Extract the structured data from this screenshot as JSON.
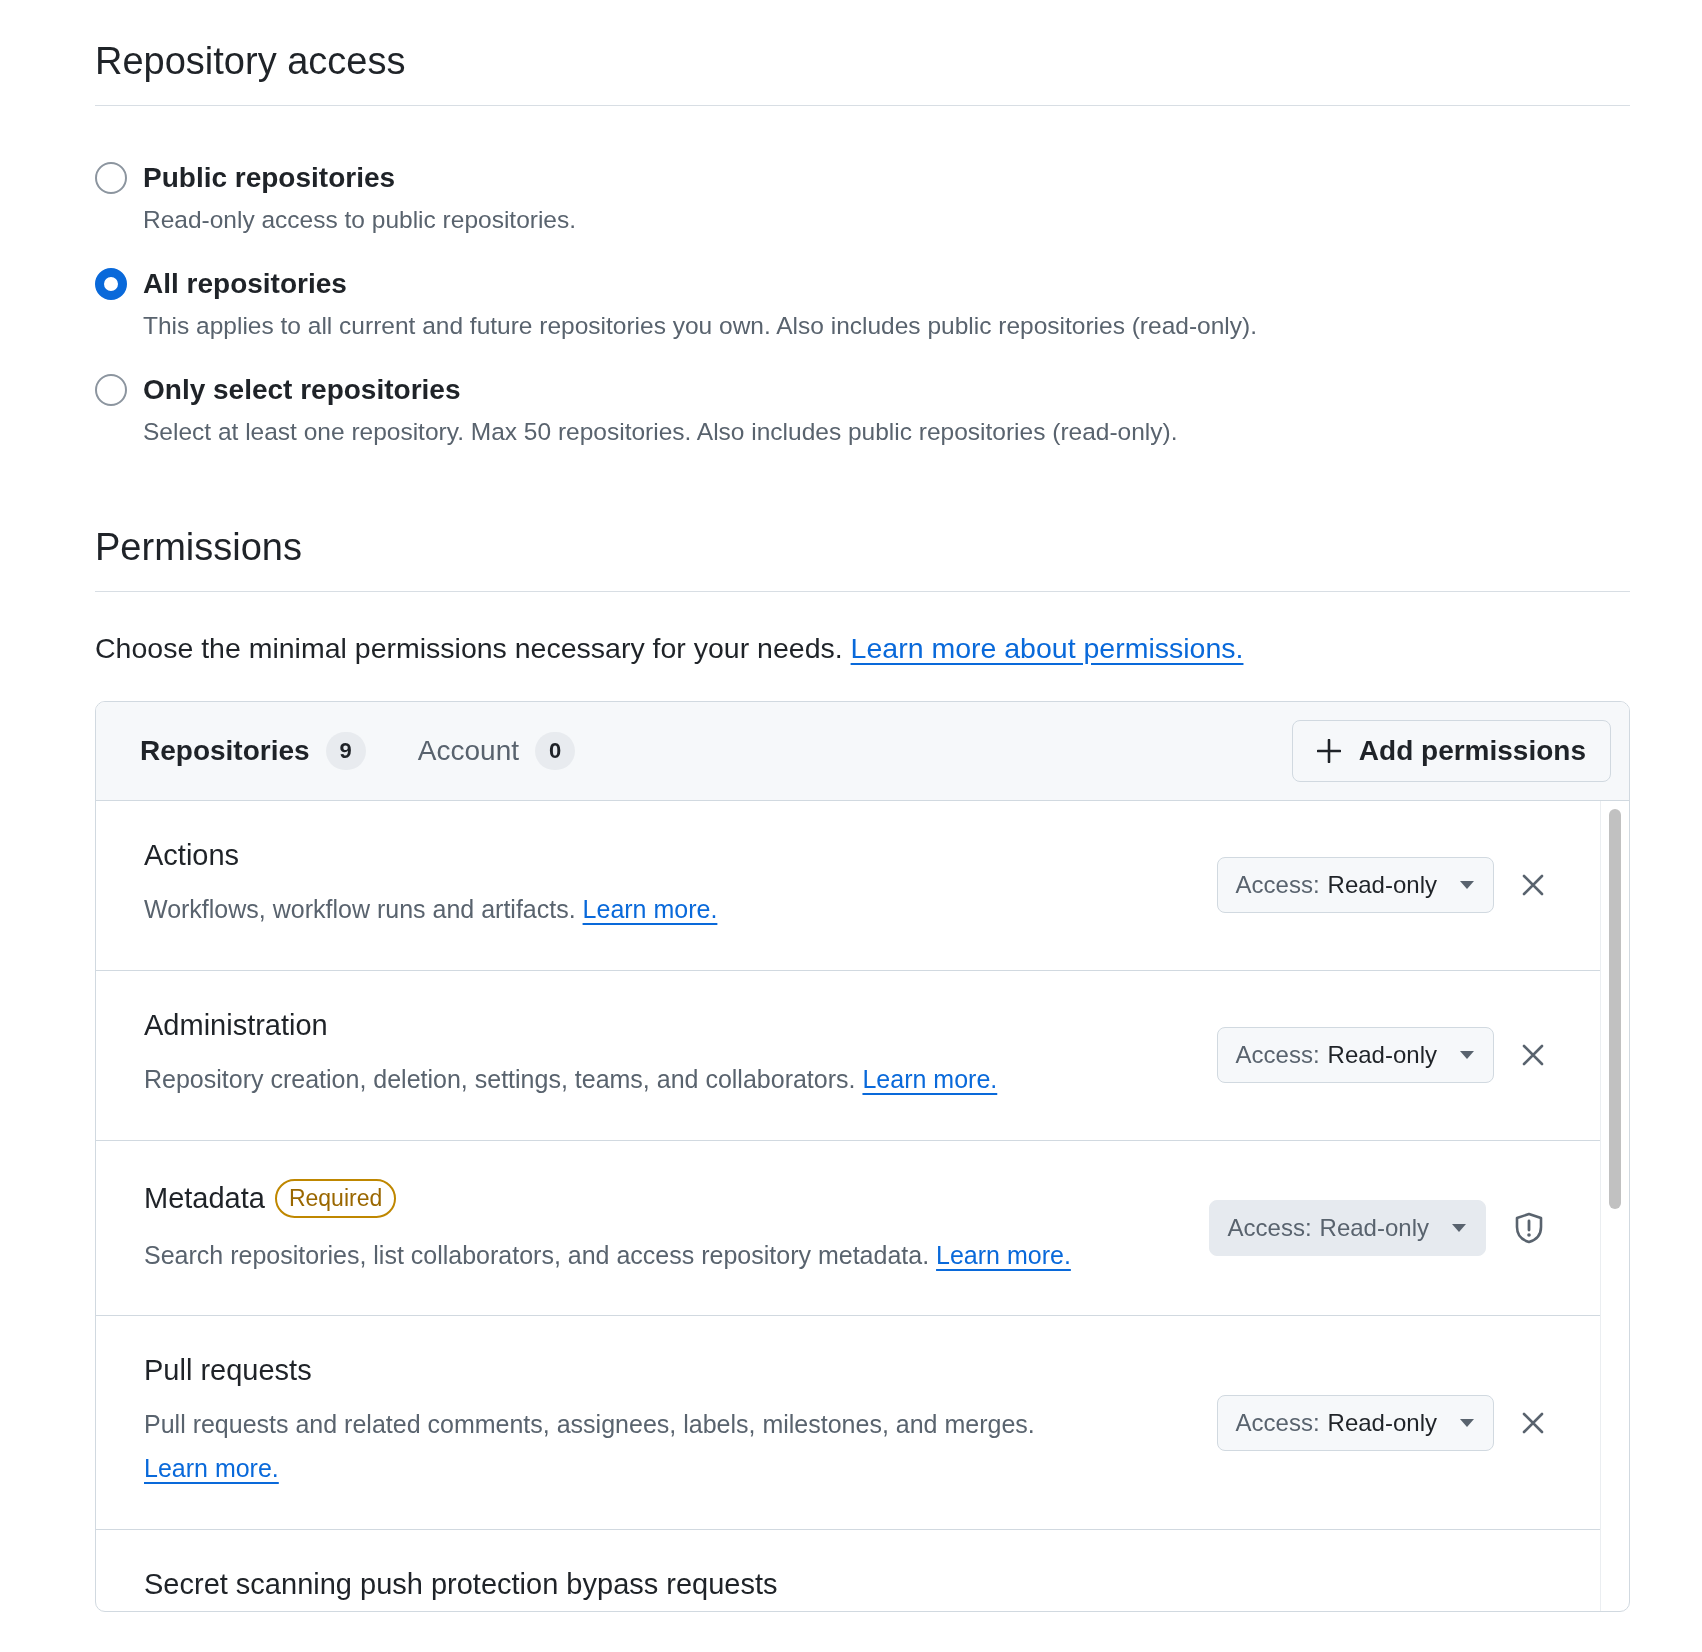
{
  "repository_access": {
    "title": "Repository access",
    "options": [
      {
        "label": "Public repositories",
        "description": "Read-only access to public repositories.",
        "selected": false
      },
      {
        "label": "All repositories",
        "description": "This applies to all current and future repositories you own. Also includes public repositories (read-only).",
        "selected": true
      },
      {
        "label": "Only select repositories",
        "description": "Select at least one repository. Max 50 repositories. Also includes public repositories (read-only).",
        "selected": false
      }
    ]
  },
  "permissions": {
    "title": "Permissions",
    "intro": "Choose the minimal permissions necessary for your needs.",
    "intro_link": "Learn more about permissions.",
    "tabs": [
      {
        "label": "Repositories",
        "count": "9",
        "selected": true
      },
      {
        "label": "Account",
        "count": "0",
        "selected": false
      }
    ],
    "add_button": "Add permissions",
    "rows": [
      {
        "name": "Actions",
        "description": "Workflows, workflow runs and artifacts.",
        "link": "Learn more.",
        "access_label": "Access:",
        "access_value": "Read-only",
        "locked": false
      },
      {
        "name": "Administration",
        "description": "Repository creation, deletion, settings, teams, and collaborators.",
        "link": "Learn more.",
        "access_label": "Access:",
        "access_value": "Read-only",
        "locked": false
      },
      {
        "name": "Metadata",
        "badge": "Required",
        "description": "Search repositories, list collaborators, and access repository metadata.",
        "link": "Learn more.",
        "access_label": "Access:",
        "access_value": "Read-only",
        "locked": true
      },
      {
        "name": "Pull requests",
        "description": "Pull requests and related comments, assignees, labels, milestones, and merges.",
        "link": "Learn more.",
        "access_label": "Access:",
        "access_value": "Read-only",
        "locked": false
      },
      {
        "name": "Secret scanning push protection bypass requests"
      }
    ]
  }
}
